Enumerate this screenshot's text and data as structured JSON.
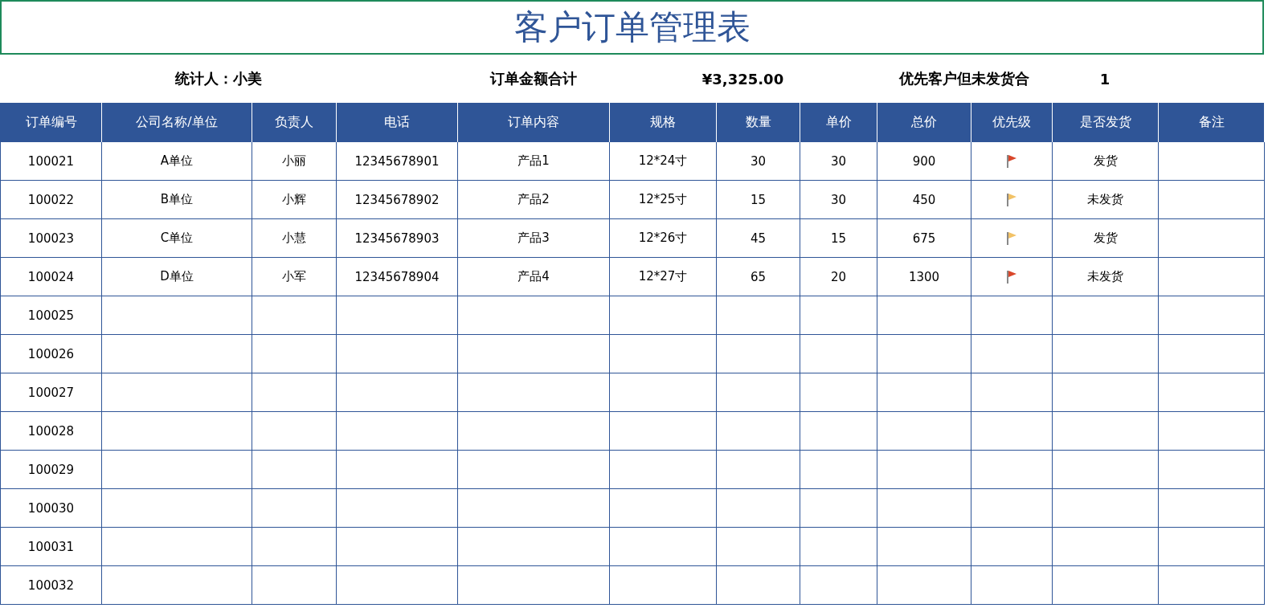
{
  "title": "客户订单管理表",
  "summary": {
    "counter_label": "统计人：小美",
    "total_label": "订单金额合计",
    "total_value": "¥3,325.00",
    "pending_label": "优先客户但未发货合",
    "pending_value": "1"
  },
  "table": {
    "columns": [
      "订单编号",
      "公司名称/单位",
      "负责人",
      "电话",
      "订单内容",
      "规格",
      "数量",
      "单价",
      "总价",
      "优先级",
      "是否发货",
      "备注"
    ],
    "rows": [
      {
        "order_no": "100021",
        "company": "A单位",
        "owner": "小丽",
        "phone": "12345678901",
        "content": "产品1",
        "spec": "12*24寸",
        "qty": "30",
        "price": "30",
        "total": "900",
        "priority": {
          "color": "#d9472b"
        },
        "shipped": "发货"
      },
      {
        "order_no": "100022",
        "company": "B单位",
        "owner": "小辉",
        "phone": "12345678902",
        "content": "产品2",
        "spec": "12*25寸",
        "qty": "15",
        "price": "30",
        "total": "450",
        "priority": {
          "color": "#f2c266"
        },
        "shipped": "未发货"
      },
      {
        "order_no": "100023",
        "company": "C单位",
        "owner": "小慧",
        "phone": "12345678903",
        "content": "产品3",
        "spec": "12*26寸",
        "qty": "45",
        "price": "15",
        "total": "675",
        "priority": {
          "color": "#f2c266"
        },
        "shipped": "发货"
      },
      {
        "order_no": "100024",
        "company": "D单位",
        "owner": "小军",
        "phone": "12345678904",
        "content": "产品4",
        "spec": "12*27寸",
        "qty": "65",
        "price": "20",
        "total": "1300",
        "priority": {
          "color": "#d9472b"
        },
        "shipped": "未发货"
      },
      {
        "order_no": "100025"
      },
      {
        "order_no": "100026"
      },
      {
        "order_no": "100027"
      },
      {
        "order_no": "100028"
      },
      {
        "order_no": "100029"
      },
      {
        "order_no": "100030"
      },
      {
        "order_no": "100031"
      },
      {
        "order_no": "100032"
      }
    ]
  }
}
